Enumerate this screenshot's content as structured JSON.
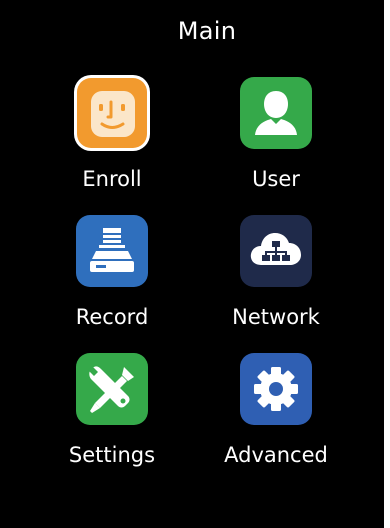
{
  "header": {
    "title": "Main"
  },
  "menu": {
    "items": [
      {
        "label": "Enroll",
        "icon": "face-enroll-icon",
        "color": "#f29a2e"
      },
      {
        "label": "User",
        "icon": "user-icon",
        "color": "#35a94a"
      },
      {
        "label": "Record",
        "icon": "record-icon",
        "color": "#2f6fbd"
      },
      {
        "label": "Network",
        "icon": "network-cloud-icon",
        "color": "#1f2a4a"
      },
      {
        "label": "Settings",
        "icon": "wrench-screwdriver-icon",
        "color": "#35a94a"
      },
      {
        "label": "Advanced",
        "icon": "gear-icon",
        "color": "#2f5fb3"
      }
    ]
  }
}
